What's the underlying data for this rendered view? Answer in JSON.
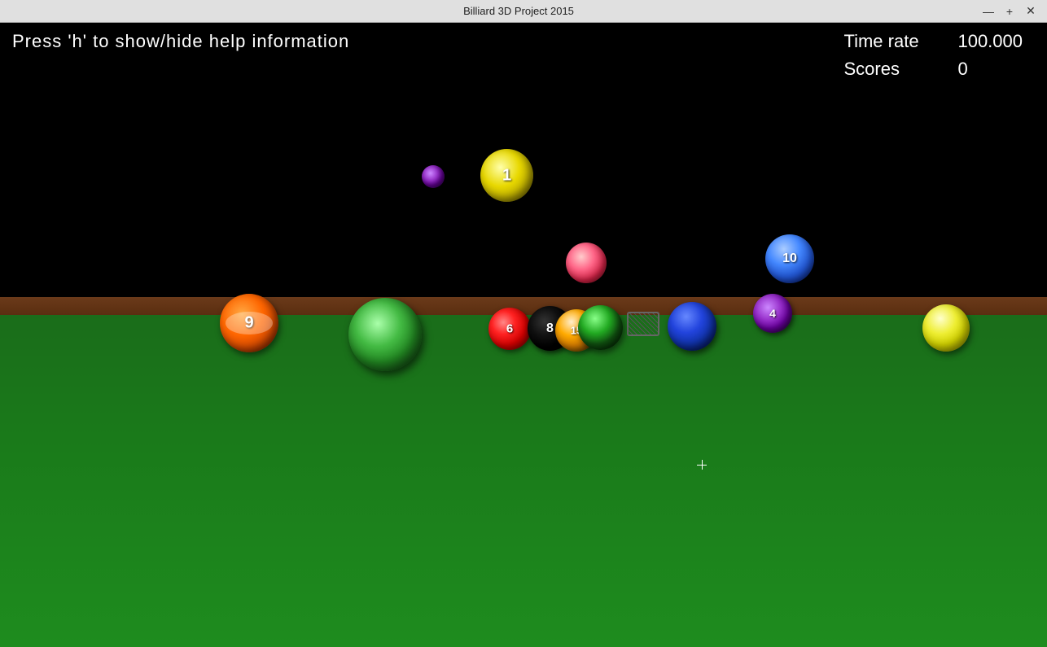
{
  "window": {
    "title": "Billiard 3D Project 2015",
    "controls": {
      "minimize": "—",
      "maximize": "+",
      "close": "✕"
    }
  },
  "hud": {
    "help_text": "Press 'h' to show/hide help information",
    "time_rate_label": "Time rate",
    "time_rate_value": "100.000",
    "scores_label": "Scores",
    "scores_value": "0"
  },
  "game": {
    "table_color": "#1a7a1a",
    "rail_color": "#5a2e10"
  }
}
